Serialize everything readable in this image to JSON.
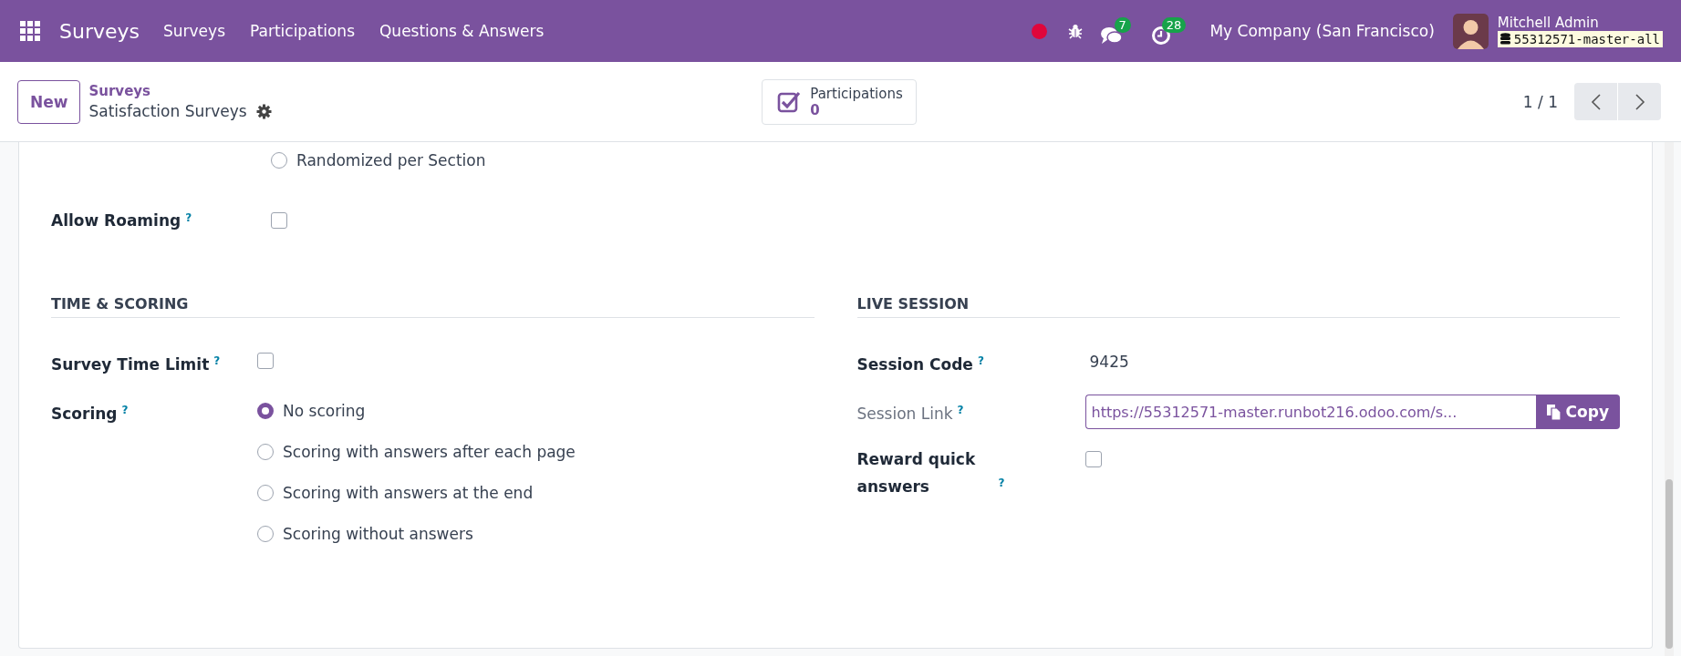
{
  "navbar": {
    "app_name": "Surveys",
    "menu": [
      "Surveys",
      "Participations",
      "Questions & Answers"
    ],
    "messages_count": "7",
    "activities_count": "28",
    "company": "My Company (San Francisco)",
    "user_name": "Mitchell Admin",
    "database": "55312571-master-all"
  },
  "control_panel": {
    "new_button": "New",
    "breadcrumb": "Surveys",
    "record_name": "Satisfaction Surveys",
    "smart_button": {
      "label": "Participations",
      "value": "0"
    },
    "pager": "1 / 1"
  },
  "form": {
    "question_selection": [
      {
        "label": "Randomized per Section",
        "selected": false
      }
    ],
    "allow_roaming": {
      "label": "Allow Roaming",
      "help": "?",
      "checked": false
    },
    "sections": [
      {
        "title": "TIME & SCORING",
        "fields": [
          {
            "kind": "checkbox",
            "label": "Survey Time Limit",
            "help": "?",
            "disabled": false,
            "checked": false
          },
          {
            "kind": "radio",
            "label": "Scoring",
            "help": "?",
            "disabled": false,
            "options": [
              {
                "label": "No scoring",
                "selected": true
              },
              {
                "label": "Scoring with answers after each page",
                "selected": false
              },
              {
                "label": "Scoring with answers at the end",
                "selected": false
              },
              {
                "label": "Scoring without answers",
                "selected": false
              }
            ]
          }
        ]
      },
      {
        "title": "LIVE SESSION",
        "fields": [
          {
            "kind": "text",
            "label": "Session Code",
            "help": "?",
            "disabled": false,
            "value": "9425"
          },
          {
            "kind": "link",
            "label": "Session Link",
            "help": "?",
            "disabled": true,
            "value": "https://55312571-master.runbot216.odoo.com/s...",
            "button": "Copy"
          },
          {
            "kind": "checkbox",
            "label": "Reward quick answers",
            "help": "?",
            "disabled": false,
            "checked": false
          }
        ]
      }
    ]
  }
}
